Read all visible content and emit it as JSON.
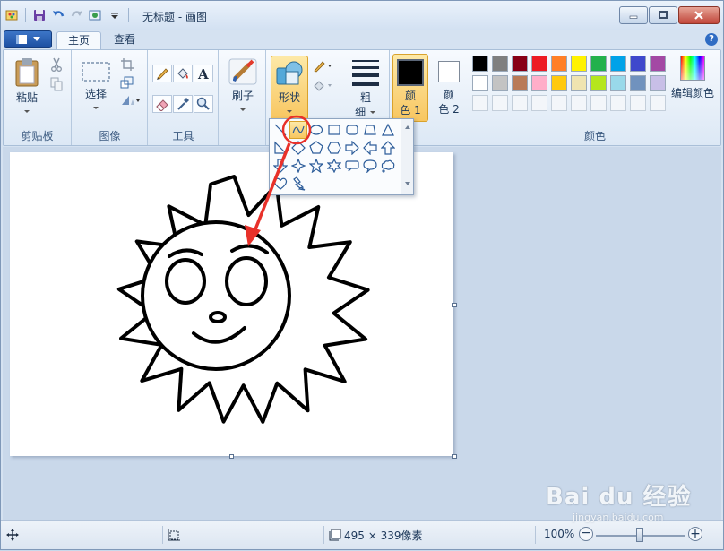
{
  "window": {
    "title": "无标题 - 画图"
  },
  "quick_access": {
    "icons": [
      "paint-app-icon",
      "save-icon",
      "undo-icon",
      "redo-icon",
      "quick-access-dropdown-icon",
      "customize-icon"
    ]
  },
  "tabs": [
    {
      "label": "主页",
      "active": true
    },
    {
      "label": "查看",
      "active": false
    }
  ],
  "ribbon": {
    "clipboard": {
      "label": "剪贴板",
      "paste": "粘贴"
    },
    "image": {
      "label": "图像",
      "select": "选择"
    },
    "tools": {
      "label": "工具"
    },
    "brushes": {
      "label": "刷子"
    },
    "shapes": {
      "label": "形状"
    },
    "size": {
      "line1": "粗",
      "line2": "细"
    },
    "color1": {
      "line1": "颜",
      "line2": "色 1",
      "value": "#000000"
    },
    "color2": {
      "line1": "颜",
      "line2": "色 2",
      "value": "#ffffff"
    },
    "colors": {
      "label": "颜色",
      "edit": "编辑颜色",
      "row1": [
        "#000000",
        "#7f7f7f",
        "#880015",
        "#ed1c24",
        "#ff7f27",
        "#fff200",
        "#22b14c",
        "#00a2e8",
        "#3f48cc",
        "#a349a4"
      ],
      "row2": [
        "#ffffff",
        "#c3c3c3",
        "#b97a57",
        "#ffaec9",
        "#ffc90e",
        "#efe4b0",
        "#b5e61d",
        "#99d9ea",
        "#7092be",
        "#c8bfe7"
      ]
    }
  },
  "canvas": {
    "fill": "#ffffff"
  },
  "statusbar": {
    "canvas_size": "495 × 339像素",
    "zoom": "100%"
  },
  "watermark": {
    "text": "Bai du 经验",
    "url": "jingyan.baidu.com"
  }
}
